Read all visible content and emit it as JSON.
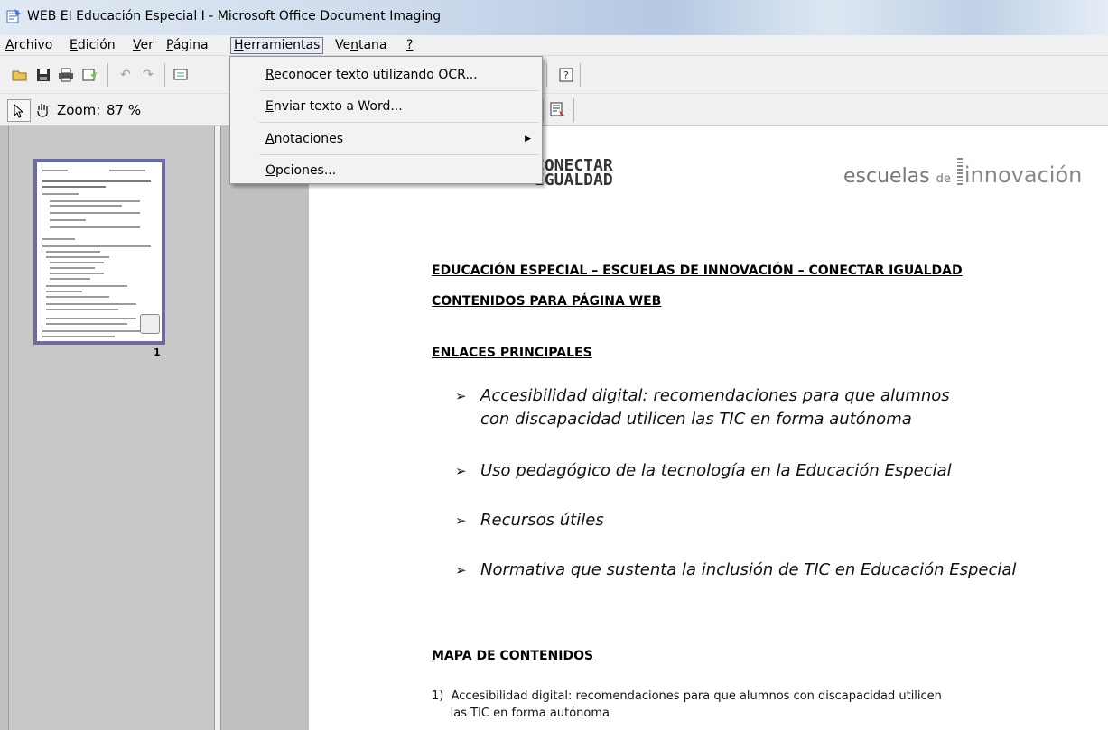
{
  "window": {
    "title": "WEB EI Educación Especial I - Microsoft Office Document Imaging"
  },
  "menubar": {
    "items": [
      {
        "label": "Archivo",
        "key": "A",
        "rest": "rchivo"
      },
      {
        "label": "Edición",
        "key": "E",
        "rest": "dición"
      },
      {
        "label": "Ver",
        "key": "V",
        "rest": "er"
      },
      {
        "label": "Página",
        "key": "P",
        "rest": "ágina"
      },
      {
        "label": "Herramientas",
        "key": "H",
        "rest": "erramientas"
      },
      {
        "label": "Ventana",
        "pre": "Ve",
        "key": "n",
        "rest": "tana"
      },
      {
        "label": "?",
        "key": "?",
        "rest": ""
      }
    ]
  },
  "toolbar": {
    "zoom_label": "Zoom:",
    "zoom_value": "87 %"
  },
  "tools_menu": {
    "items": [
      {
        "key": "R",
        "rest": "econocer texto utilizando OCR..."
      },
      {
        "key": "E",
        "rest": "nviar texto a Word..."
      },
      {
        "key": "A",
        "rest": "notaciones",
        "submenu": true
      },
      {
        "key": "O",
        "rest": "pciones..."
      }
    ]
  },
  "thumbnails": {
    "page_number": "1"
  },
  "document": {
    "logo_left": "CONECTAR\nIGUALDAD",
    "logo_right_a": "escuelas",
    "logo_right_de": "de",
    "logo_right_b": "innovación",
    "heading1": "EDUCACIÓN ESPECIAL – ESCUELAS DE INNOVACIÓN – CONECTAR IGUALDAD",
    "heading2": "CONTENIDOS PARA PÁGINA WEB",
    "section1": "ENLACES PRINCIPALES",
    "links": [
      "Accesibilidad digital: recomendaciones para que alumnos con discapacidad utilicen las TIC en forma autónoma",
      "Uso pedagógico de la tecnología en la Educación Especial",
      "Recursos útiles",
      "Normativa que sustenta la inclusión de TIC en Educación Especial"
    ],
    "section2": "MAPA DE CONTENIDOS",
    "map_item1": "1)  Accesibilidad digital: recomendaciones para que alumnos con discapacidad utilicen\n     las TIC en forma autónoma"
  }
}
